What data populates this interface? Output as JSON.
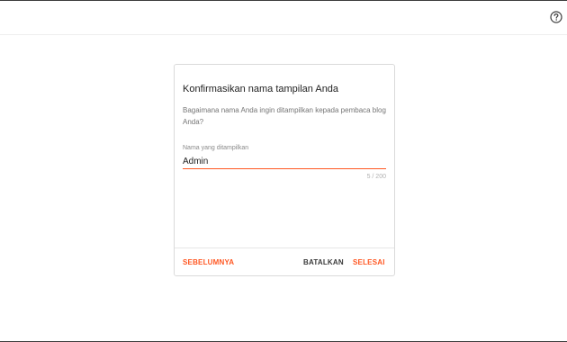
{
  "header": {
    "help_icon": "help-circle-icon"
  },
  "dialog": {
    "title": "Konfirmasikan nama tampilan Anda",
    "description": "Bagaimana nama Anda ingin ditampilkan kepada pembaca blog Anda?",
    "field": {
      "label": "Nama yang ditampilkan",
      "value": "Admin",
      "counter": "5 / 200"
    },
    "buttons": {
      "previous": "SEBELUMNYA",
      "cancel": "BATALKAN",
      "done": "SELESAI"
    }
  },
  "colors": {
    "accent": "#ff5722",
    "text_primary": "#212121",
    "text_secondary": "#757575"
  }
}
